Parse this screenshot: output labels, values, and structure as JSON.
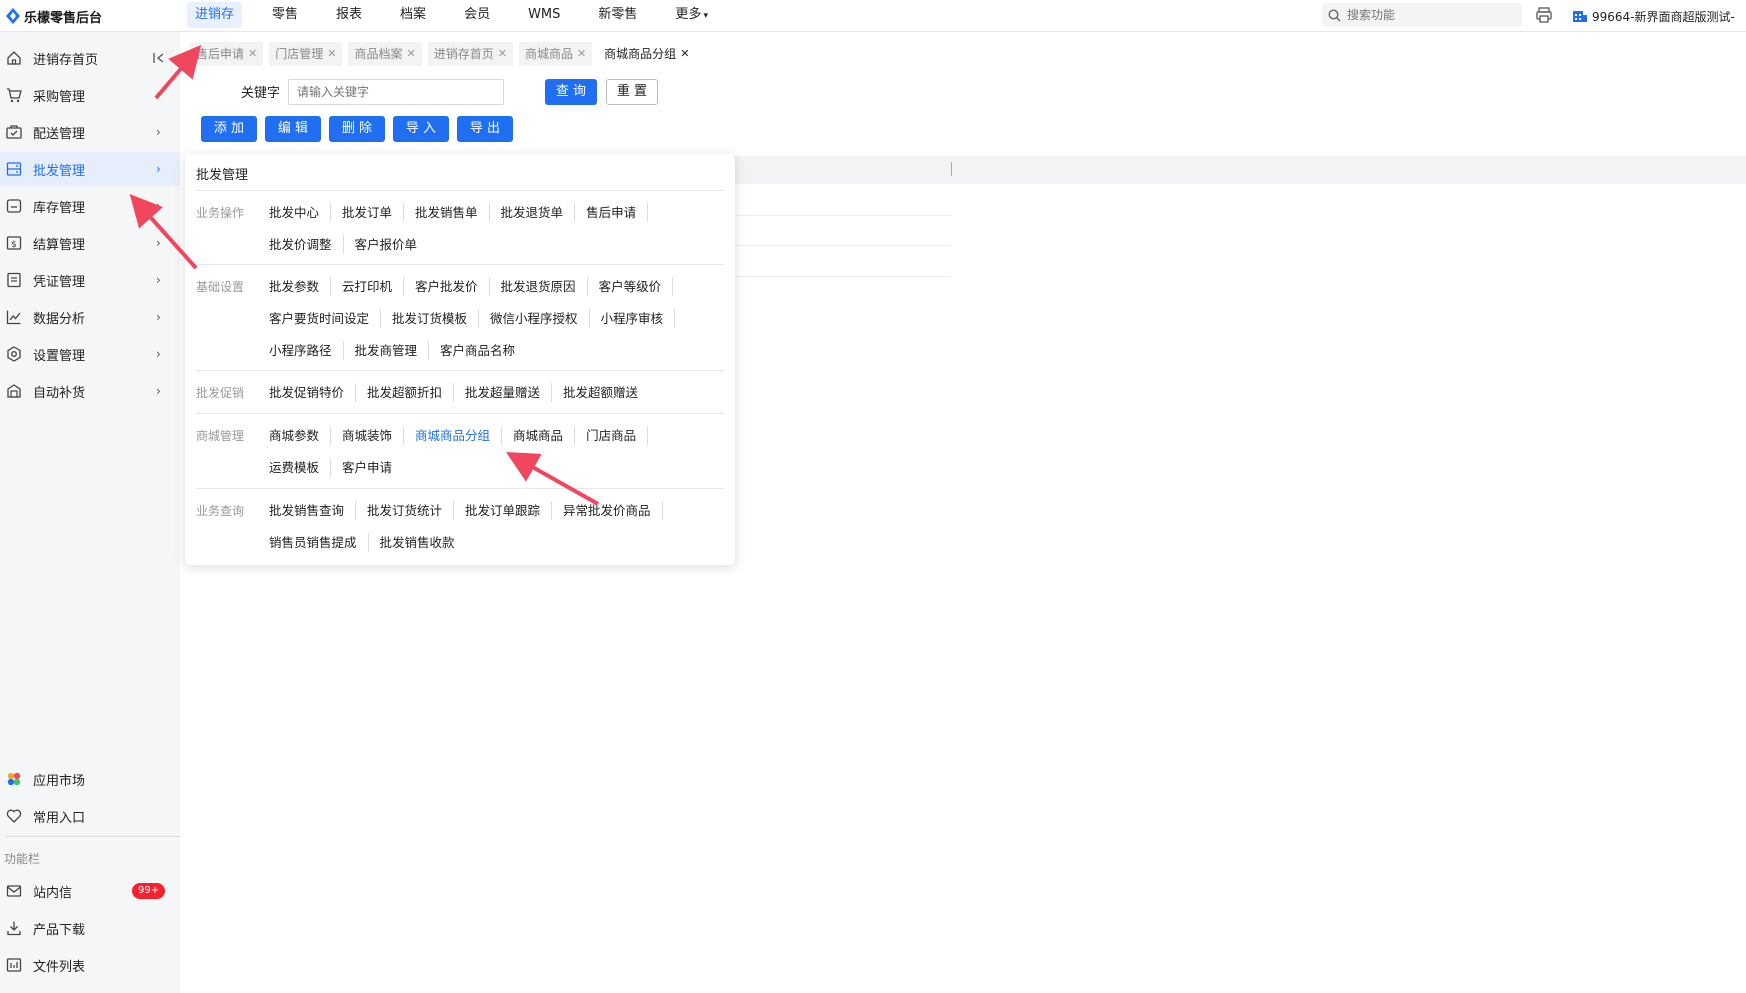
{
  "app": {
    "title": "乐檬零售后台"
  },
  "topnav": [
    {
      "label": "进销存",
      "active": true
    },
    {
      "label": "零售"
    },
    {
      "label": "报表"
    },
    {
      "label": "档案"
    },
    {
      "label": "会员"
    },
    {
      "label": "WMS"
    },
    {
      "label": "新零售"
    },
    {
      "label": "更多"
    }
  ],
  "search": {
    "placeholder": "搜索功能"
  },
  "store": {
    "name": "99664-新界面商超版测试-"
  },
  "sidebar": {
    "items": [
      {
        "label": "进销存首页",
        "icon": "home-icon"
      },
      {
        "label": "采购管理",
        "icon": "cart-icon"
      },
      {
        "label": "配送管理",
        "icon": "truck-icon"
      },
      {
        "label": "批发管理",
        "icon": "wholesale-icon",
        "active": true
      },
      {
        "label": "库存管理",
        "icon": "inventory-icon"
      },
      {
        "label": "结算管理",
        "icon": "settlement-icon"
      },
      {
        "label": "凭证管理",
        "icon": "voucher-icon"
      },
      {
        "label": "数据分析",
        "icon": "chart-icon"
      },
      {
        "label": "设置管理",
        "icon": "settings-icon"
      },
      {
        "label": "自动补货",
        "icon": "replenish-icon"
      }
    ],
    "bottom": [
      {
        "label": "应用市场",
        "icon": "app-market-icon"
      },
      {
        "label": "常用入口",
        "icon": "heart-icon"
      }
    ],
    "section_label": "功能栏",
    "tools": [
      {
        "label": "站内信",
        "icon": "mail-icon",
        "badge": "99+"
      },
      {
        "label": "产品下载",
        "icon": "download-icon"
      },
      {
        "label": "文件列表",
        "icon": "file-list-icon"
      }
    ]
  },
  "tabs": [
    {
      "label": "售后申请"
    },
    {
      "label": "门店管理"
    },
    {
      "label": "商品档案"
    },
    {
      "label": "进销存首页"
    },
    {
      "label": "商城商品"
    },
    {
      "label": "商城商品分组",
      "active": true
    }
  ],
  "query": {
    "keyword_label": "关键字",
    "keyword_placeholder": "请输入关键字",
    "search_btn": "查 询",
    "reset_btn": "重 置"
  },
  "actions": {
    "add": "添 加",
    "edit": "编 辑",
    "delete": "删 除",
    "import": "导 入",
    "export": "导 出"
  },
  "panel": {
    "title": "批发管理",
    "groups": [
      {
        "label": "业务操作",
        "links": [
          "批发中心",
          "批发订单",
          "批发销售单",
          "批发退货单",
          "售后申请",
          "批发价调整",
          "客户报价单"
        ]
      },
      {
        "label": "基础设置",
        "links": [
          "批发参数",
          "云打印机",
          "客户批发价",
          "批发退货原因",
          "客户等级价",
          "客户要货时间设定",
          "批发订货模板",
          "微信小程序授权",
          "小程序审核",
          "小程序路径",
          "批发商管理",
          "客户商品名称"
        ]
      },
      {
        "label": "批发促销",
        "links": [
          "批发促销特价",
          "批发超额折扣",
          "批发超量赠送",
          "批发超额赠送"
        ]
      },
      {
        "label": "商城管理",
        "links": [
          "商城参数",
          "商城装饰",
          "商城商品分组",
          "商城商品",
          "门店商品",
          "运费模板",
          "客户申请"
        ]
      },
      {
        "label": "业务查询",
        "links": [
          "批发销售查询",
          "批发订货统计",
          "批发订单跟踪",
          "异常批发价商品",
          "销售员销售提成",
          "批发销售收款"
        ]
      }
    ],
    "highlight": "商城商品分组"
  },
  "colors": {
    "accent": "#1f6ff0",
    "badge": "#f5222d",
    "arrow": "#f0475f"
  }
}
